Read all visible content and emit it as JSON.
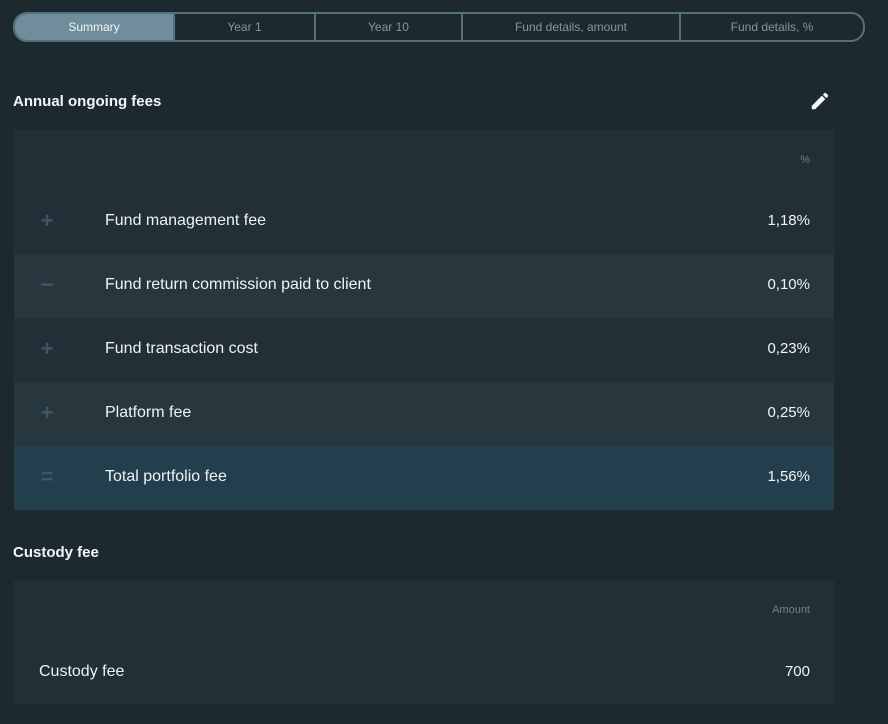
{
  "tabs": [
    {
      "label": "Summary",
      "active": true
    },
    {
      "label": "Year 1",
      "active": false
    },
    {
      "label": "Year 10",
      "active": false
    },
    {
      "label": "Fund details, amount",
      "active": false
    },
    {
      "label": "Fund details, %",
      "active": false
    }
  ],
  "ongoing_fees": {
    "title": "Annual ongoing fees",
    "edit_icon": "pencil-icon",
    "column_header": "%",
    "rows": [
      {
        "sign": "+",
        "sign_icon": "plus-icon",
        "label": "Fund management fee",
        "value": "1,18%"
      },
      {
        "sign": "−",
        "sign_icon": "minus-icon",
        "label": "Fund return commission paid to client",
        "value": "0,10%"
      },
      {
        "sign": "+",
        "sign_icon": "plus-icon",
        "label": "Fund transaction cost",
        "value": "0,23%"
      },
      {
        "sign": "+",
        "sign_icon": "plus-icon",
        "label": "Platform fee",
        "value": "0,25%"
      },
      {
        "sign": "=",
        "sign_icon": "equals-icon",
        "label": "Total portfolio fee",
        "value": "1,56%"
      }
    ]
  },
  "custody": {
    "title": "Custody fee",
    "column_header": "Amount",
    "label": "Custody fee",
    "value": "700"
  },
  "colors": {
    "background": "#1c2a30",
    "panel": "#222f36",
    "row_alt": "#28373e",
    "total_row": "#233e4d",
    "tab_active": "#6f8d9a",
    "tab_border": "#55717d"
  }
}
